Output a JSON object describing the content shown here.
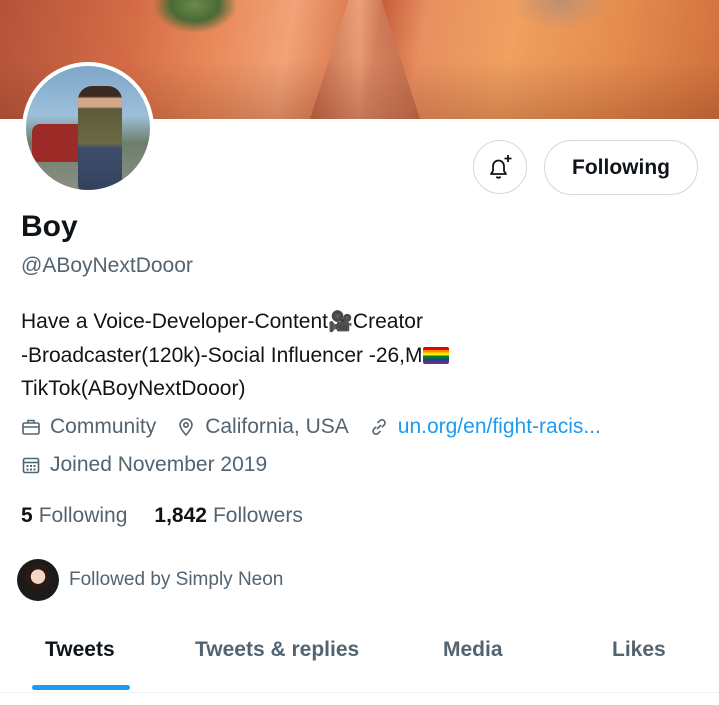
{
  "profile": {
    "name": "Boy",
    "handle": "@ABoyNextDooor",
    "bio_line1_a": "Have a Voice-Developer-Content",
    "bio_line1_emoji": "🎥",
    "bio_line1_b": "Creator",
    "bio_line2": "-Broadcaster(120k)-Social Influencer -26,M",
    "bio_line3": "TikTok(ABoyNextDooor)",
    "category": "Community",
    "location": "California, USA",
    "website": "un.org/en/fight-racis...",
    "joined": "Joined November 2019"
  },
  "actions": {
    "notify_icon": "bell-plus-icon",
    "follow_label": "Following"
  },
  "stats": {
    "following_count": "5",
    "following_label": "Following",
    "followers_count": "1,842",
    "followers_label": "Followers"
  },
  "followed_by": "Followed by Simply Neon",
  "tabs": [
    {
      "label": "Tweets",
      "active": true
    },
    {
      "label": "Tweets & replies",
      "active": false
    },
    {
      "label": "Media",
      "active": false
    },
    {
      "label": "Likes",
      "active": false
    }
  ],
  "colors": {
    "accent": "#1d9bf0",
    "text_primary": "#0f1419",
    "text_secondary": "#536471",
    "border": "#cfd9de"
  }
}
